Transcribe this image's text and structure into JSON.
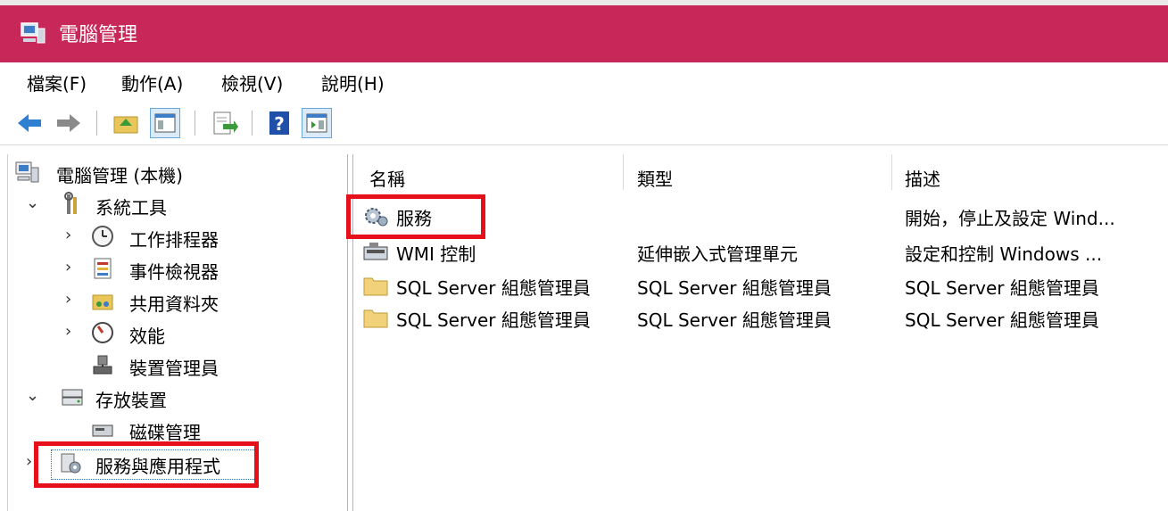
{
  "window": {
    "title": "電腦管理",
    "accent_color": "#c8275a"
  },
  "menu": {
    "items": [
      "檔案(F)",
      "動作(A)",
      "檢視(V)",
      "說明(H)"
    ]
  },
  "toolbar": {
    "buttons": [
      "back-arrow-icon",
      "forward-arrow-icon",
      "up-folder-icon",
      "show-hide-tree-icon",
      "export-list-icon",
      "help-icon",
      "show-hide-action-pane-icon"
    ]
  },
  "tree": {
    "root": "電腦管理 (本機)",
    "system_tools": {
      "label": "系統工具",
      "children": [
        "工作排程器",
        "事件檢視器",
        "共用資料夾",
        "效能",
        "裝置管理員"
      ]
    },
    "storage": {
      "label": "存放裝置",
      "children": [
        "磁碟管理"
      ]
    },
    "services_apps": {
      "label": "服務與應用程式"
    }
  },
  "list": {
    "columns": [
      "名稱",
      "類型",
      "描述"
    ],
    "rows": [
      {
        "name": "服務",
        "type": "",
        "desc": "開始，停止及設定 Wind..."
      },
      {
        "name": "WMI 控制",
        "type": "延伸嵌入式管理單元",
        "desc": "設定和控制 Windows ..."
      },
      {
        "name": "SQL Server 組態管理員",
        "type": "SQL Server 組態管理員",
        "desc": "SQL Server 組態管理員"
      },
      {
        "name": "SQL Server 組態管理員",
        "type": "SQL Server 組態管理員",
        "desc": "SQL Server 組態管理員"
      }
    ]
  },
  "highlight_color": "#e5101a"
}
